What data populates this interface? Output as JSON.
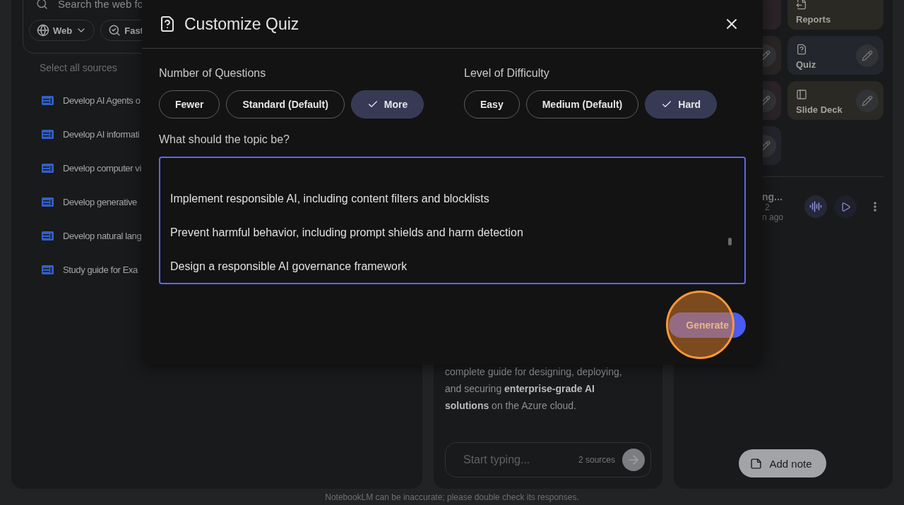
{
  "sources_panel": {
    "search": {
      "placeholder": "Search the web fo"
    },
    "chips": [
      {
        "label": "Web",
        "kind": "web"
      },
      {
        "label": "Fast",
        "kind": "fast"
      }
    ],
    "select_all": "Select all sources",
    "sources": [
      "Develop AI Agents o",
      "Develop AI informati",
      "Develop computer vi",
      "Develop generative",
      "Develop natural lang",
      "Study guide for Exa"
    ]
  },
  "chat_panel": {
    "summary": "complete guide for designing, deploying, and securing **enterprise-grade AI solutions** on the Azure cloud.",
    "input": {
      "placeholder": "Start typing..."
    },
    "source_count": "2 sources"
  },
  "studio_panel": {
    "tiles": [
      {
        "color": "#2a2327",
        "editable": false
      },
      {
        "label": "Reports",
        "kind": "report",
        "color": "#2a2923",
        "editable": false
      },
      {
        "color": "#2a2525",
        "editable": true
      },
      {
        "label": "Quiz",
        "kind": "quiz",
        "color": "#23262c",
        "editable": true
      },
      {
        "color": "#2a2429",
        "editable": true
      },
      {
        "label": "Slide Deck",
        "kind": "slides",
        "color": "#2a2923",
        "editable": true
      },
      {
        "color": "#24252c",
        "editable": true
      }
    ],
    "audio_item": {
      "title": "ng...",
      "meta": "2",
      "time": "n ago"
    },
    "add_note": "Add note"
  },
  "dialog": {
    "title": "Customize Quiz",
    "groups": [
      {
        "label": "Number of Questions",
        "options": [
          {
            "label": "Fewer",
            "selected": false
          },
          {
            "label": "Standard (Default)",
            "selected": false
          },
          {
            "label": "More",
            "selected": true
          }
        ]
      },
      {
        "label": "Level of Difficulty",
        "options": [
          {
            "label": "Easy",
            "selected": false
          },
          {
            "label": "Medium (Default)",
            "selected": false
          },
          {
            "label": "Hard",
            "selected": true
          }
        ]
      }
    ],
    "topic": {
      "label": "What should the topic be?",
      "lines": [
        "Implement responsible AI, including content filters and blocklists",
        "Prevent harmful behavior, including prompt shields and harm detection",
        "Design a responsible AI governance framework"
      ]
    },
    "generate": {
      "label": "Generate",
      "highlighted": true
    }
  },
  "footer": "NotebookLM can be inaccurate; please double check its responses."
}
